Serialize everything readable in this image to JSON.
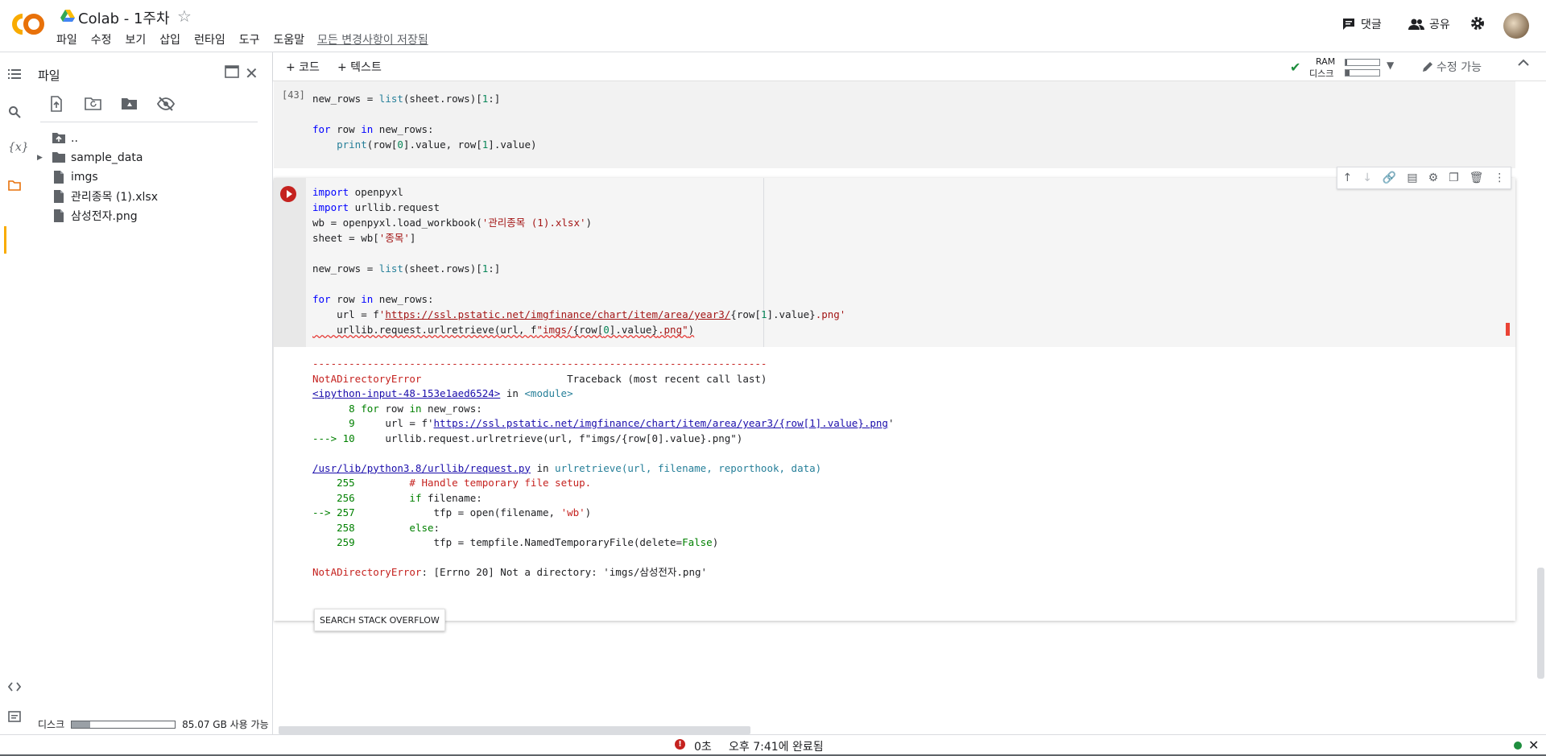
{
  "header": {
    "title": "Colab - 1주차",
    "menu": [
      "파일",
      "수정",
      "보기",
      "삽입",
      "런타임",
      "도구",
      "도움말"
    ],
    "saved_status": "모든 변경사항이 저장됨",
    "comment_label": "댓글",
    "share_label": "공유",
    "icons": [
      "colab-logo",
      "drive-icon",
      "star-icon",
      "comment-icon",
      "share-icon",
      "gear-icon",
      "avatar"
    ]
  },
  "rail": {
    "icons": [
      "toc-icon",
      "search-icon",
      "variables-icon",
      "folder-icon",
      "code-snippets-icon",
      "terminal-icon"
    ],
    "variables_glyph": "{x}"
  },
  "file_panel": {
    "title": "파일",
    "tree": [
      {
        "name": "..",
        "type": "parent"
      },
      {
        "name": "sample_data",
        "type": "folder"
      },
      {
        "name": "imgs",
        "type": "file"
      },
      {
        "name": "관리종목 (1).xlsx",
        "type": "file"
      },
      {
        "name": "삼성전자.png",
        "type": "file"
      }
    ],
    "disk_label": "디스크",
    "disk_available": "85.07 GB 사용 가능",
    "disk_used_fraction": 0.18
  },
  "toolbar": {
    "add_code": "+ 코드",
    "add_text": "+ 텍스트",
    "ram_label": "RAM",
    "disk_label": "디스크",
    "ram_fraction": 0.04,
    "disk_fraction": 0.12,
    "edit_mode": "수정 가능"
  },
  "cell1": {
    "exec_count": "[43]"
  },
  "output": {
    "search_so_button": "SEARCH STACK OVERFLOW"
  },
  "status_bar": {
    "elapsed": "0초",
    "completed": "오후 7:41에 완료됨"
  },
  "colors": {
    "accent_orange": "#f9ab00",
    "error_red": "#c5221f",
    "ok_green": "#1e8e3e"
  }
}
